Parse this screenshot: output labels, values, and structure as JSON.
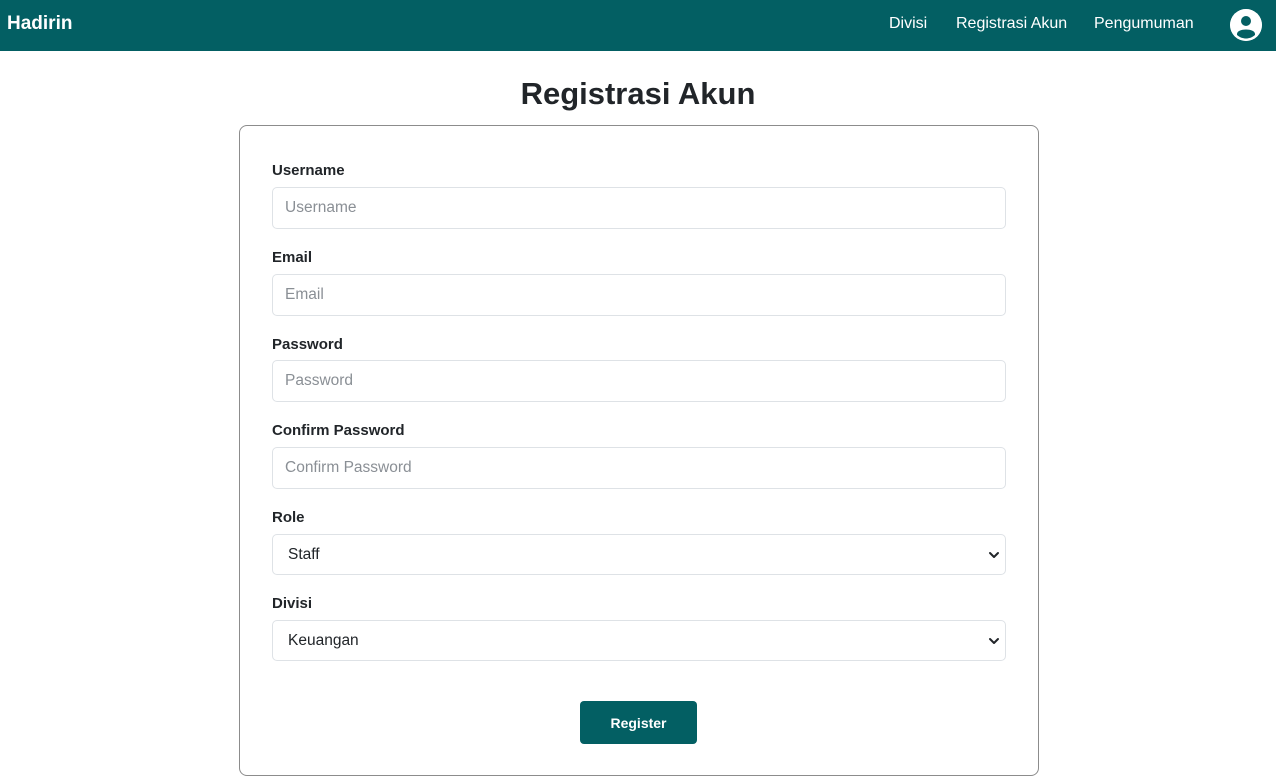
{
  "navbar": {
    "brand": "Hadirin",
    "links": [
      "Divisi",
      "Registrasi Akun",
      "Pengumuman"
    ],
    "avatar_icon": "user-circle-icon"
  },
  "page": {
    "title": "Registrasi Akun"
  },
  "form": {
    "username": {
      "label": "Username",
      "placeholder": "Username",
      "value": ""
    },
    "email": {
      "label": "Email",
      "placeholder": "Email",
      "value": ""
    },
    "password": {
      "label": "Password",
      "placeholder": "Password",
      "value": ""
    },
    "confirm_password": {
      "label": "Confirm Password",
      "placeholder": "Confirm Password",
      "value": ""
    },
    "role": {
      "label": "Role",
      "selected": "Staff"
    },
    "divisi": {
      "label": "Divisi",
      "selected": "Keuangan"
    },
    "submit_label": "Register"
  },
  "colors": {
    "primary": "#035f63",
    "border": "#dee2e6"
  }
}
